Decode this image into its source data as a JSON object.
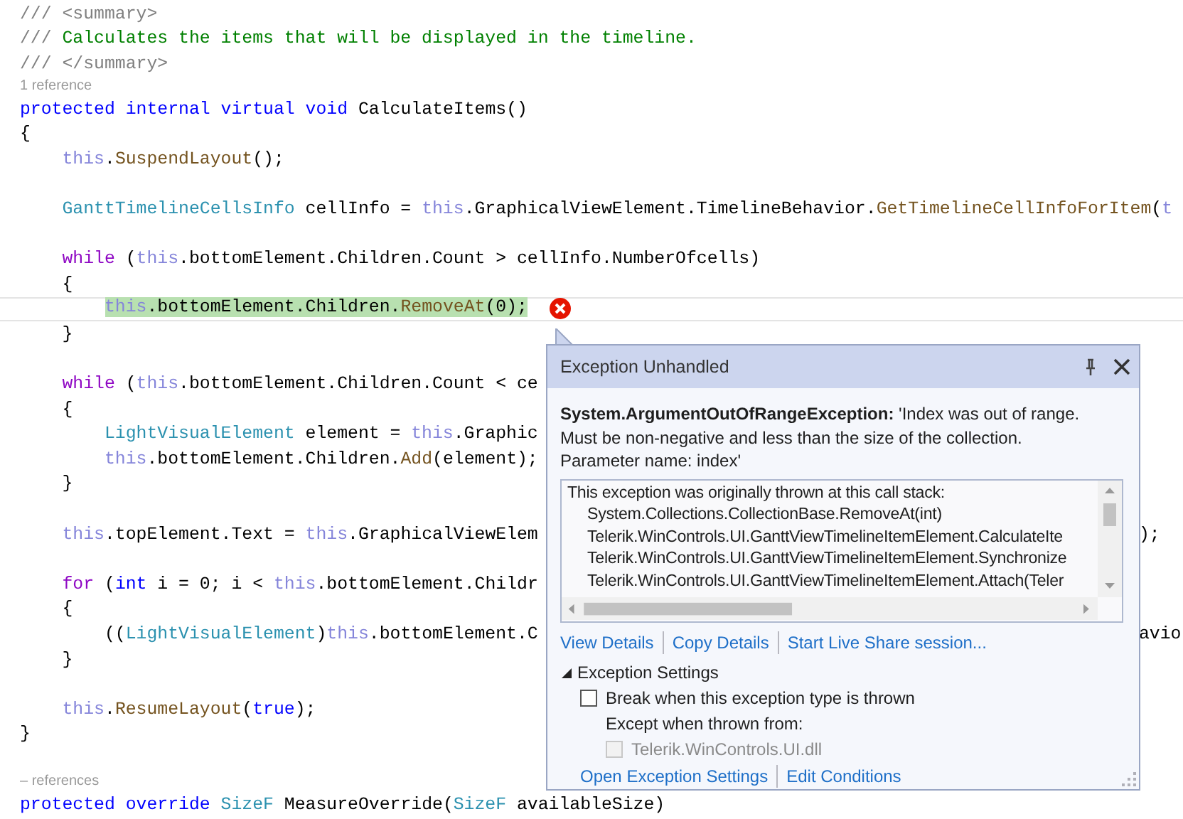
{
  "editor": {
    "lines": [
      {
        "kind": "code",
        "tokens": [
          {
            "kind": "doc",
            "text": "/// <summary>"
          }
        ]
      },
      {
        "kind": "code",
        "tokens": [
          {
            "kind": "doc",
            "text": "///"
          },
          {
            "kind": "comment",
            "text": " Calculates the items that will be displayed in the timeline."
          }
        ]
      },
      {
        "kind": "code",
        "tokens": [
          {
            "kind": "doc",
            "text": "/// </summary>"
          }
        ]
      },
      {
        "kind": "lens",
        "text": "1 reference"
      },
      {
        "kind": "code",
        "tokens": [
          {
            "kind": "keyword",
            "text": "protected"
          },
          {
            "kind": "keyword",
            "text": " internal"
          },
          {
            "kind": "keyword",
            "text": " virtual"
          },
          {
            "kind": "keyword",
            "text": " void"
          },
          {
            "kind": "plain",
            "text": " CalculateItems()"
          }
        ]
      },
      {
        "kind": "code",
        "tokens": [
          {
            "kind": "plain",
            "text": "{"
          }
        ]
      },
      {
        "kind": "code",
        "tokens": [
          {
            "kind": "this",
            "text": "    this"
          },
          {
            "kind": "plain",
            "text": "."
          },
          {
            "kind": "method",
            "text": "SuspendLayout"
          },
          {
            "kind": "plain",
            "text": "();"
          }
        ]
      },
      {
        "kind": "blank"
      },
      {
        "kind": "code",
        "tokens": [
          {
            "kind": "type",
            "text": "    GanttTimelineCellsInfo"
          },
          {
            "kind": "plain",
            "text": " cellInfo = "
          },
          {
            "kind": "this",
            "text": "this"
          },
          {
            "kind": "plain",
            "text": ".GraphicalViewElement.TimelineBehavior."
          },
          {
            "kind": "method",
            "text": "GetTimelineCellInfoForItem"
          },
          {
            "kind": "plain",
            "text": "("
          },
          {
            "kind": "this",
            "text": "t"
          }
        ]
      },
      {
        "kind": "blank"
      },
      {
        "kind": "code",
        "tokens": [
          {
            "kind": "control",
            "text": "    while"
          },
          {
            "kind": "plain",
            "text": " ("
          },
          {
            "kind": "this",
            "text": "this"
          },
          {
            "kind": "plain",
            "text": ".bottomElement.Children.Count > cellInfo.NumberOfcells)"
          }
        ]
      },
      {
        "kind": "code",
        "tokens": [
          {
            "kind": "plain",
            "text": "    {"
          }
        ]
      },
      {
        "kind": "code",
        "current": true,
        "highlighted": true,
        "error": true,
        "tokens": [
          {
            "kind": "this",
            "text": "        this"
          },
          {
            "kind": "plain",
            "text": ".bottomElement.Children."
          },
          {
            "kind": "method",
            "text": "RemoveAt"
          },
          {
            "kind": "plain",
            "text": "(0);"
          }
        ]
      },
      {
        "kind": "code",
        "tokens": [
          {
            "kind": "plain",
            "text": "    }"
          }
        ]
      },
      {
        "kind": "blank"
      },
      {
        "kind": "code",
        "tokens": [
          {
            "kind": "control",
            "text": "    while"
          },
          {
            "kind": "plain",
            "text": " ("
          },
          {
            "kind": "this",
            "text": "this"
          },
          {
            "kind": "plain",
            "text": ".bottomElement.Children.Count < ce"
          }
        ]
      },
      {
        "kind": "code",
        "tokens": [
          {
            "kind": "plain",
            "text": "    {"
          }
        ]
      },
      {
        "kind": "code",
        "tokens": [
          {
            "kind": "type",
            "text": "        LightVisualElement"
          },
          {
            "kind": "plain",
            "text": " element = "
          },
          {
            "kind": "this",
            "text": "this"
          },
          {
            "kind": "plain",
            "text": ".Graphic"
          }
        ]
      },
      {
        "kind": "code",
        "tokens": [
          {
            "kind": "this",
            "text": "        this"
          },
          {
            "kind": "plain",
            "text": ".bottomElement.Children."
          },
          {
            "kind": "method",
            "text": "Add"
          },
          {
            "kind": "plain",
            "text": "(element);"
          }
        ]
      },
      {
        "kind": "code",
        "tokens": [
          {
            "kind": "plain",
            "text": "    }"
          }
        ]
      },
      {
        "kind": "blank"
      },
      {
        "kind": "code",
        "tokens": [
          {
            "kind": "this",
            "text": "    this"
          },
          {
            "kind": "plain",
            "text": ".topElement.Text = "
          },
          {
            "kind": "this",
            "text": "this"
          },
          {
            "kind": "plain",
            "text": ".GraphicalViewElem"
          }
        ],
        "tail": ");"
      },
      {
        "kind": "blank"
      },
      {
        "kind": "code",
        "tokens": [
          {
            "kind": "control",
            "text": "    for"
          },
          {
            "kind": "plain",
            "text": " ("
          },
          {
            "kind": "keyword",
            "text": "int"
          },
          {
            "kind": "plain",
            "text": " i = 0; i < "
          },
          {
            "kind": "this",
            "text": "this"
          },
          {
            "kind": "plain",
            "text": ".bottomElement.Childr"
          }
        ]
      },
      {
        "kind": "code",
        "tokens": [
          {
            "kind": "plain",
            "text": "    {"
          }
        ]
      },
      {
        "kind": "code",
        "tokens": [
          {
            "kind": "plain",
            "text": "        (("
          },
          {
            "kind": "type",
            "text": "LightVisualElement"
          },
          {
            "kind": "plain",
            "text": ")"
          },
          {
            "kind": "this",
            "text": "this"
          },
          {
            "kind": "plain",
            "text": ".bottomElement.C"
          }
        ],
        "tail": "avio"
      },
      {
        "kind": "code",
        "tokens": [
          {
            "kind": "plain",
            "text": "    }"
          }
        ]
      },
      {
        "kind": "blank"
      },
      {
        "kind": "code",
        "tokens": [
          {
            "kind": "this",
            "text": "    this"
          },
          {
            "kind": "plain",
            "text": "."
          },
          {
            "kind": "method",
            "text": "ResumeLayout"
          },
          {
            "kind": "plain",
            "text": "("
          },
          {
            "kind": "keyword",
            "text": "true"
          },
          {
            "kind": "plain",
            "text": ");"
          }
        ]
      },
      {
        "kind": "code",
        "tokens": [
          {
            "kind": "plain",
            "text": "}"
          }
        ]
      },
      {
        "kind": "blank"
      },
      {
        "kind": "lens",
        "text": "– references"
      },
      {
        "kind": "code",
        "tokens": [
          {
            "kind": "keyword",
            "text": "protected"
          },
          {
            "kind": "keyword",
            "text": " override"
          },
          {
            "kind": "type",
            "text": " SizeF"
          },
          {
            "kind": "plain",
            "text": " MeasureOverride("
          },
          {
            "kind": "type",
            "text": "SizeF"
          },
          {
            "kind": "plain",
            "text": " availableSize)"
          }
        ]
      }
    ]
  },
  "exception_popup": {
    "title": "Exception Unhandled",
    "message": [
      "**System.ArgumentOutOfRangeException:** 'Index was out of range.",
      "Must be non-negative and less than the size of the collection.",
      "Parameter name: index'"
    ],
    "call_stack": {
      "heading": "This exception was originally thrown at this call stack:",
      "frames": [
        "System.Collections.CollectionBase.RemoveAt(int)",
        "Telerik.WinControls.UI.GanttViewTimelineItemElement.CalculateIte",
        "Telerik.WinControls.UI.GanttViewTimelineItemElement.Synchronize",
        "Telerik.WinControls.UI.GanttViewTimelineItemElement.Attach(Teler"
      ]
    },
    "links": [
      "View Details",
      "Copy Details",
      "Start Live Share session..."
    ],
    "settings": {
      "title": "Exception Settings",
      "expanded": true,
      "break_option": {
        "label": "Break when this exception type is thrown",
        "checked": false
      },
      "except_label": "Except when thrown from:",
      "module": {
        "label": "Telerik.WinControls.UI.dll",
        "checked": false,
        "disabled": true
      }
    },
    "bottom_links": [
      "Open Exception Settings",
      "Edit Conditions"
    ]
  }
}
